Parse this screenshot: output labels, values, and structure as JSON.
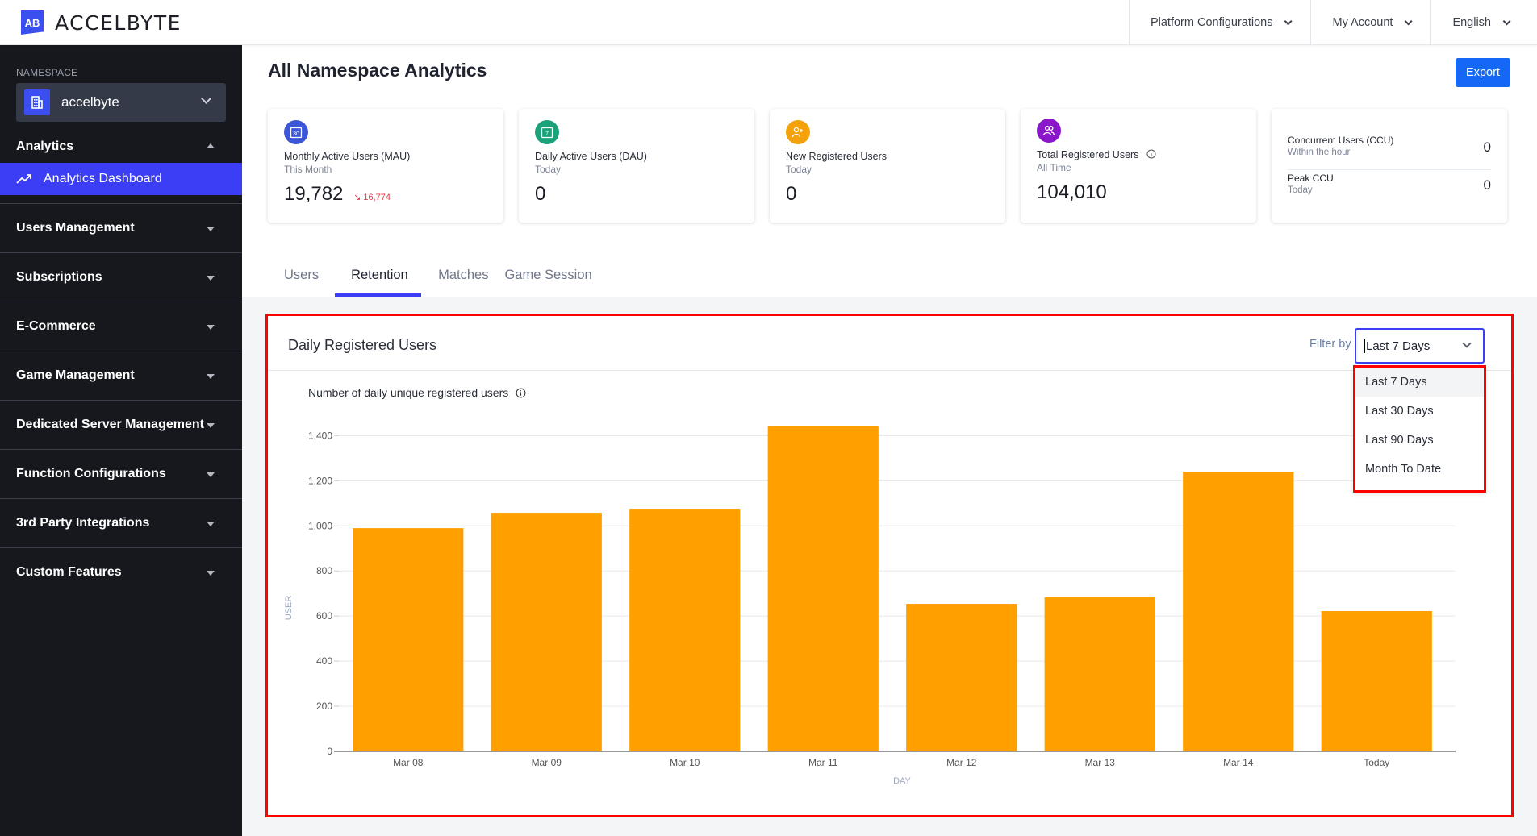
{
  "header": {
    "logo_mark": "AB",
    "logo_text": "ACCELBYTE",
    "menus": [
      "Platform Configurations",
      "My Account",
      "English"
    ]
  },
  "sidebar": {
    "namespace_label": "NAMESPACE",
    "namespace_value": "accelbyte",
    "groups": [
      {
        "label": "Analytics",
        "expanded": true,
        "items": [
          {
            "label": "Analytics Dashboard",
            "active": true,
            "icon": "trending-up-icon"
          }
        ]
      },
      {
        "label": "Users Management",
        "expanded": false
      },
      {
        "label": "Subscriptions",
        "expanded": false
      },
      {
        "label": "E-Commerce",
        "expanded": false
      },
      {
        "label": "Game Management",
        "expanded": false
      },
      {
        "label": "Dedicated Server Management",
        "expanded": false
      },
      {
        "label": "Function Configurations",
        "expanded": false
      },
      {
        "label": "3rd Party Integrations",
        "expanded": false
      },
      {
        "label": "Custom Features",
        "expanded": false
      }
    ]
  },
  "page": {
    "title": "All Namespace Analytics",
    "export_label": "Export"
  },
  "cards": [
    {
      "label": "Monthly Active Users (MAU)",
      "sub": "This Month",
      "value": "19,782",
      "delta": "16,774",
      "delta_direction": "down",
      "icon": "calendar-30-icon",
      "color": "#3d56d6",
      "icon_text": "30"
    },
    {
      "label": "Daily Active Users (DAU)",
      "sub": "Today",
      "value": "0",
      "icon": "calendar-7-icon",
      "color": "#1aa37a",
      "icon_text": "7"
    },
    {
      "label": "New Registered Users",
      "sub": "Today",
      "value": "0",
      "icon": "user-plus-icon",
      "color": "#f4a20c"
    },
    {
      "label": "Total Registered Users",
      "sub": "All Time",
      "value": "104,010",
      "icon": "users-icon",
      "color": "#8a17c9"
    }
  ],
  "ccu_card": {
    "rows": [
      {
        "label": "Concurrent Users (CCU)",
        "sub": "Within the hour",
        "value": "0"
      },
      {
        "label": "Peak CCU",
        "sub": "Today",
        "value": "0"
      }
    ]
  },
  "tabs": [
    {
      "label": "Users",
      "active": false
    },
    {
      "label": "Retention",
      "active": true
    },
    {
      "label": "Matches",
      "active": false
    },
    {
      "label": "Game Session",
      "active": false
    }
  ],
  "panel": {
    "title": "Daily Registered Users",
    "filter_label": "Filter by",
    "filter_value": "Last 7 Days",
    "filter_options": [
      "Last 7 Days",
      "Last 30 Days",
      "Last 90 Days",
      "Month To Date"
    ],
    "chart_subtitle": "Number of daily unique registered users"
  },
  "chart_data": {
    "type": "bar",
    "title": "Number of daily unique registered users",
    "xlabel": "DAY",
    "ylabel": "USER",
    "categories": [
      "Mar 08",
      "Mar 09",
      "Mar 10",
      "Mar 11",
      "Mar 12",
      "Mar 13",
      "Mar 14",
      "Today"
    ],
    "values": [
      990,
      1058,
      1076,
      1443,
      654,
      683,
      1240,
      622
    ],
    "ylim": [
      0,
      1400
    ],
    "yticks": [
      0,
      200,
      400,
      600,
      800,
      1000,
      1200,
      1400
    ],
    "ytick_labels": [
      "0",
      "200",
      "400",
      "600",
      "800",
      "1,000",
      "1,200",
      "1,400"
    ],
    "grid": true,
    "bar_color": "#ffa000"
  }
}
